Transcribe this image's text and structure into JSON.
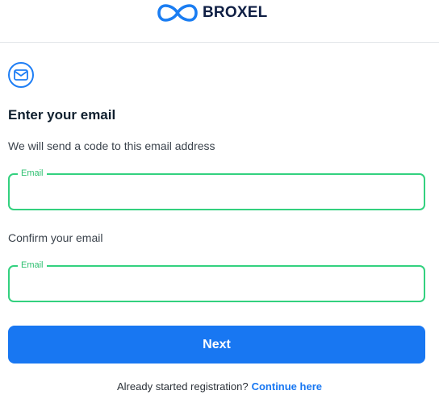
{
  "header": {
    "brand_name": "BROXEL",
    "brand_color": "#1a7df2",
    "logo_icon": "infinity-logo-icon"
  },
  "intro": {
    "icon": "mail-icon",
    "title": "Enter your email",
    "subtitle": "We will send a code to this email address"
  },
  "email_field": {
    "legend": "Email",
    "value": "",
    "placeholder": ""
  },
  "confirm": {
    "label": "Confirm your email",
    "legend": "Email",
    "value": "",
    "placeholder": ""
  },
  "actions": {
    "next_label": "Next"
  },
  "footer": {
    "prompt": "Already started registration?",
    "link_text": "Continue here"
  },
  "colors": {
    "accent": "#1877f2",
    "field_border": "#33d17f"
  }
}
